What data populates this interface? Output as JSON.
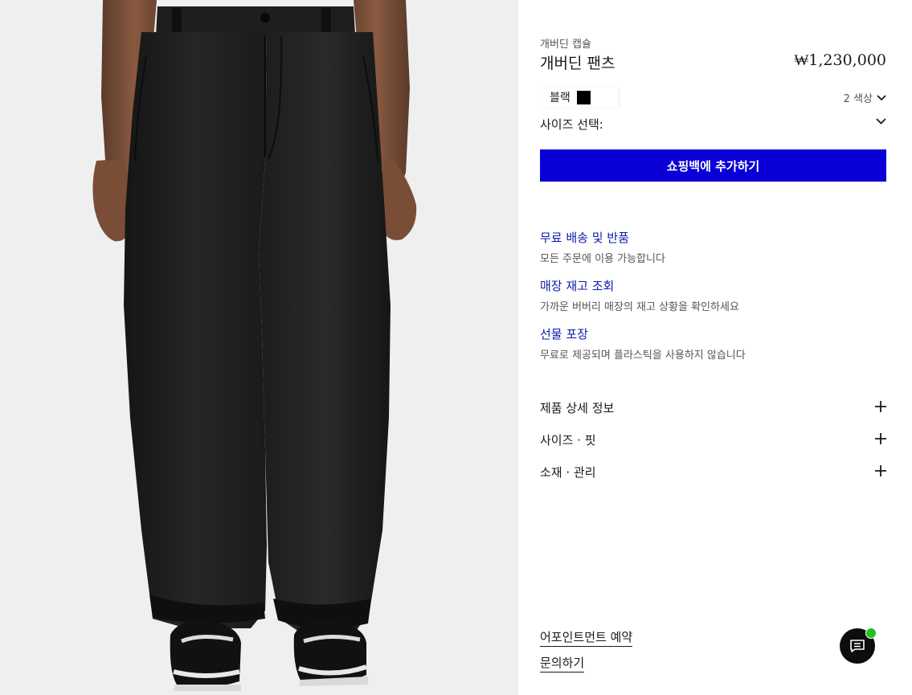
{
  "product": {
    "collection": "개버딘 캡슐",
    "title": "개버딘 팬츠",
    "price": "₩1,230,000"
  },
  "color": {
    "selected_name": "블랙",
    "swatch_color": "#000000",
    "count_label": "2 색상"
  },
  "size": {
    "label": "사이즈 선택:"
  },
  "cta": {
    "add_to_bag_label": "쇼핑백에 추가하기",
    "color": "#0a00d7"
  },
  "services": [
    {
      "title": "무료 배송 및 반품",
      "desc": "모든 주문에 이용 가능합니다"
    },
    {
      "title": "매장 재고 조회",
      "desc": "가까운 버버리 매장의 재고 상황을 확인하세요"
    },
    {
      "title": "선물 포장",
      "desc": "무료로 제공되며 플라스틱을 사용하지 않습니다"
    }
  ],
  "accordion": [
    {
      "label": "제품 상세 정보",
      "icon": "plus-icon"
    },
    {
      "label": "사이즈 · 핏",
      "icon": "plus-icon"
    },
    {
      "label": "소재 · 관리",
      "icon": "plus-icon"
    }
  ],
  "links": {
    "appointment": "어포인트먼트 예약",
    "inquiry": "문의하기"
  },
  "chat": {
    "icon": "chat-icon",
    "status_color": "#1fc21f"
  }
}
